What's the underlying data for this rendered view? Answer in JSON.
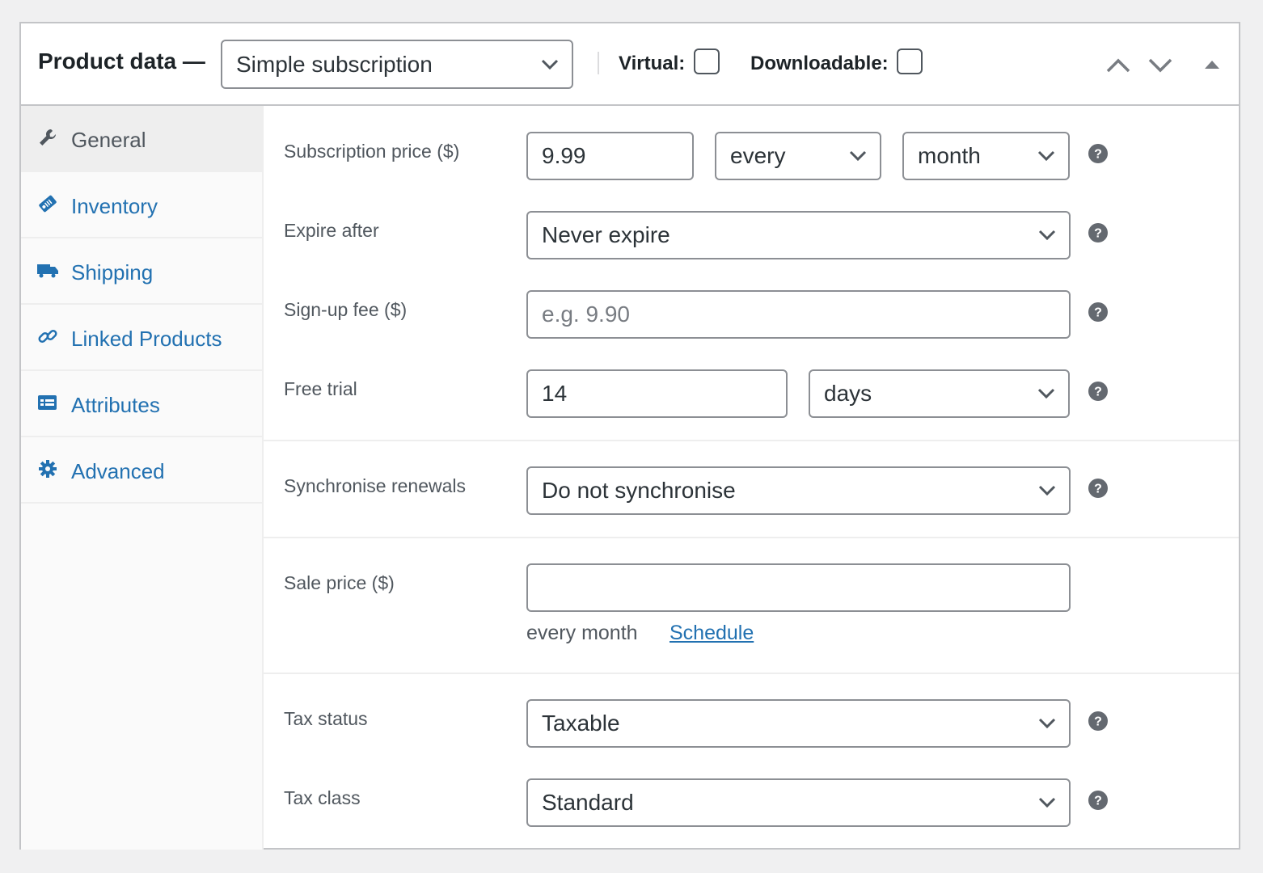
{
  "header": {
    "title": "Product data —",
    "product_type": "Simple subscription",
    "virtual_label": "Virtual:",
    "downloadable_label": "Downloadable:",
    "virtual_checked": false,
    "downloadable_checked": false
  },
  "tabs": [
    {
      "label": "General",
      "icon": "wrench-icon",
      "active": true
    },
    {
      "label": "Inventory",
      "icon": "tag-icon",
      "active": false
    },
    {
      "label": "Shipping",
      "icon": "truck-icon",
      "active": false
    },
    {
      "label": "Linked Products",
      "icon": "link-icon",
      "active": false
    },
    {
      "label": "Attributes",
      "icon": "list-icon",
      "active": false
    },
    {
      "label": "Advanced",
      "icon": "gear-icon",
      "active": false
    }
  ],
  "fields": {
    "subscription_price": {
      "label": "Subscription price ($)",
      "value": "9.99",
      "interval": "every",
      "period": "month"
    },
    "expire_after": {
      "label": "Expire after",
      "value": "Never expire"
    },
    "signup_fee": {
      "label": "Sign-up fee ($)",
      "value": "",
      "placeholder": "e.g. 9.90"
    },
    "free_trial": {
      "label": "Free trial",
      "value": "14",
      "period": "days"
    },
    "synchronise": {
      "label": "Synchronise renewals",
      "value": "Do not synchronise"
    },
    "sale_price": {
      "label": "Sale price ($)",
      "value": "",
      "description": "every month",
      "schedule_link": "Schedule"
    },
    "tax_status": {
      "label": "Tax status",
      "value": "Taxable"
    },
    "tax_class": {
      "label": "Tax class",
      "value": "Standard"
    }
  },
  "colors": {
    "link": "#2271b1",
    "text": "#1d2327",
    "muted": "#50575e",
    "border": "#8c8f94",
    "help_icon": "#646970"
  }
}
